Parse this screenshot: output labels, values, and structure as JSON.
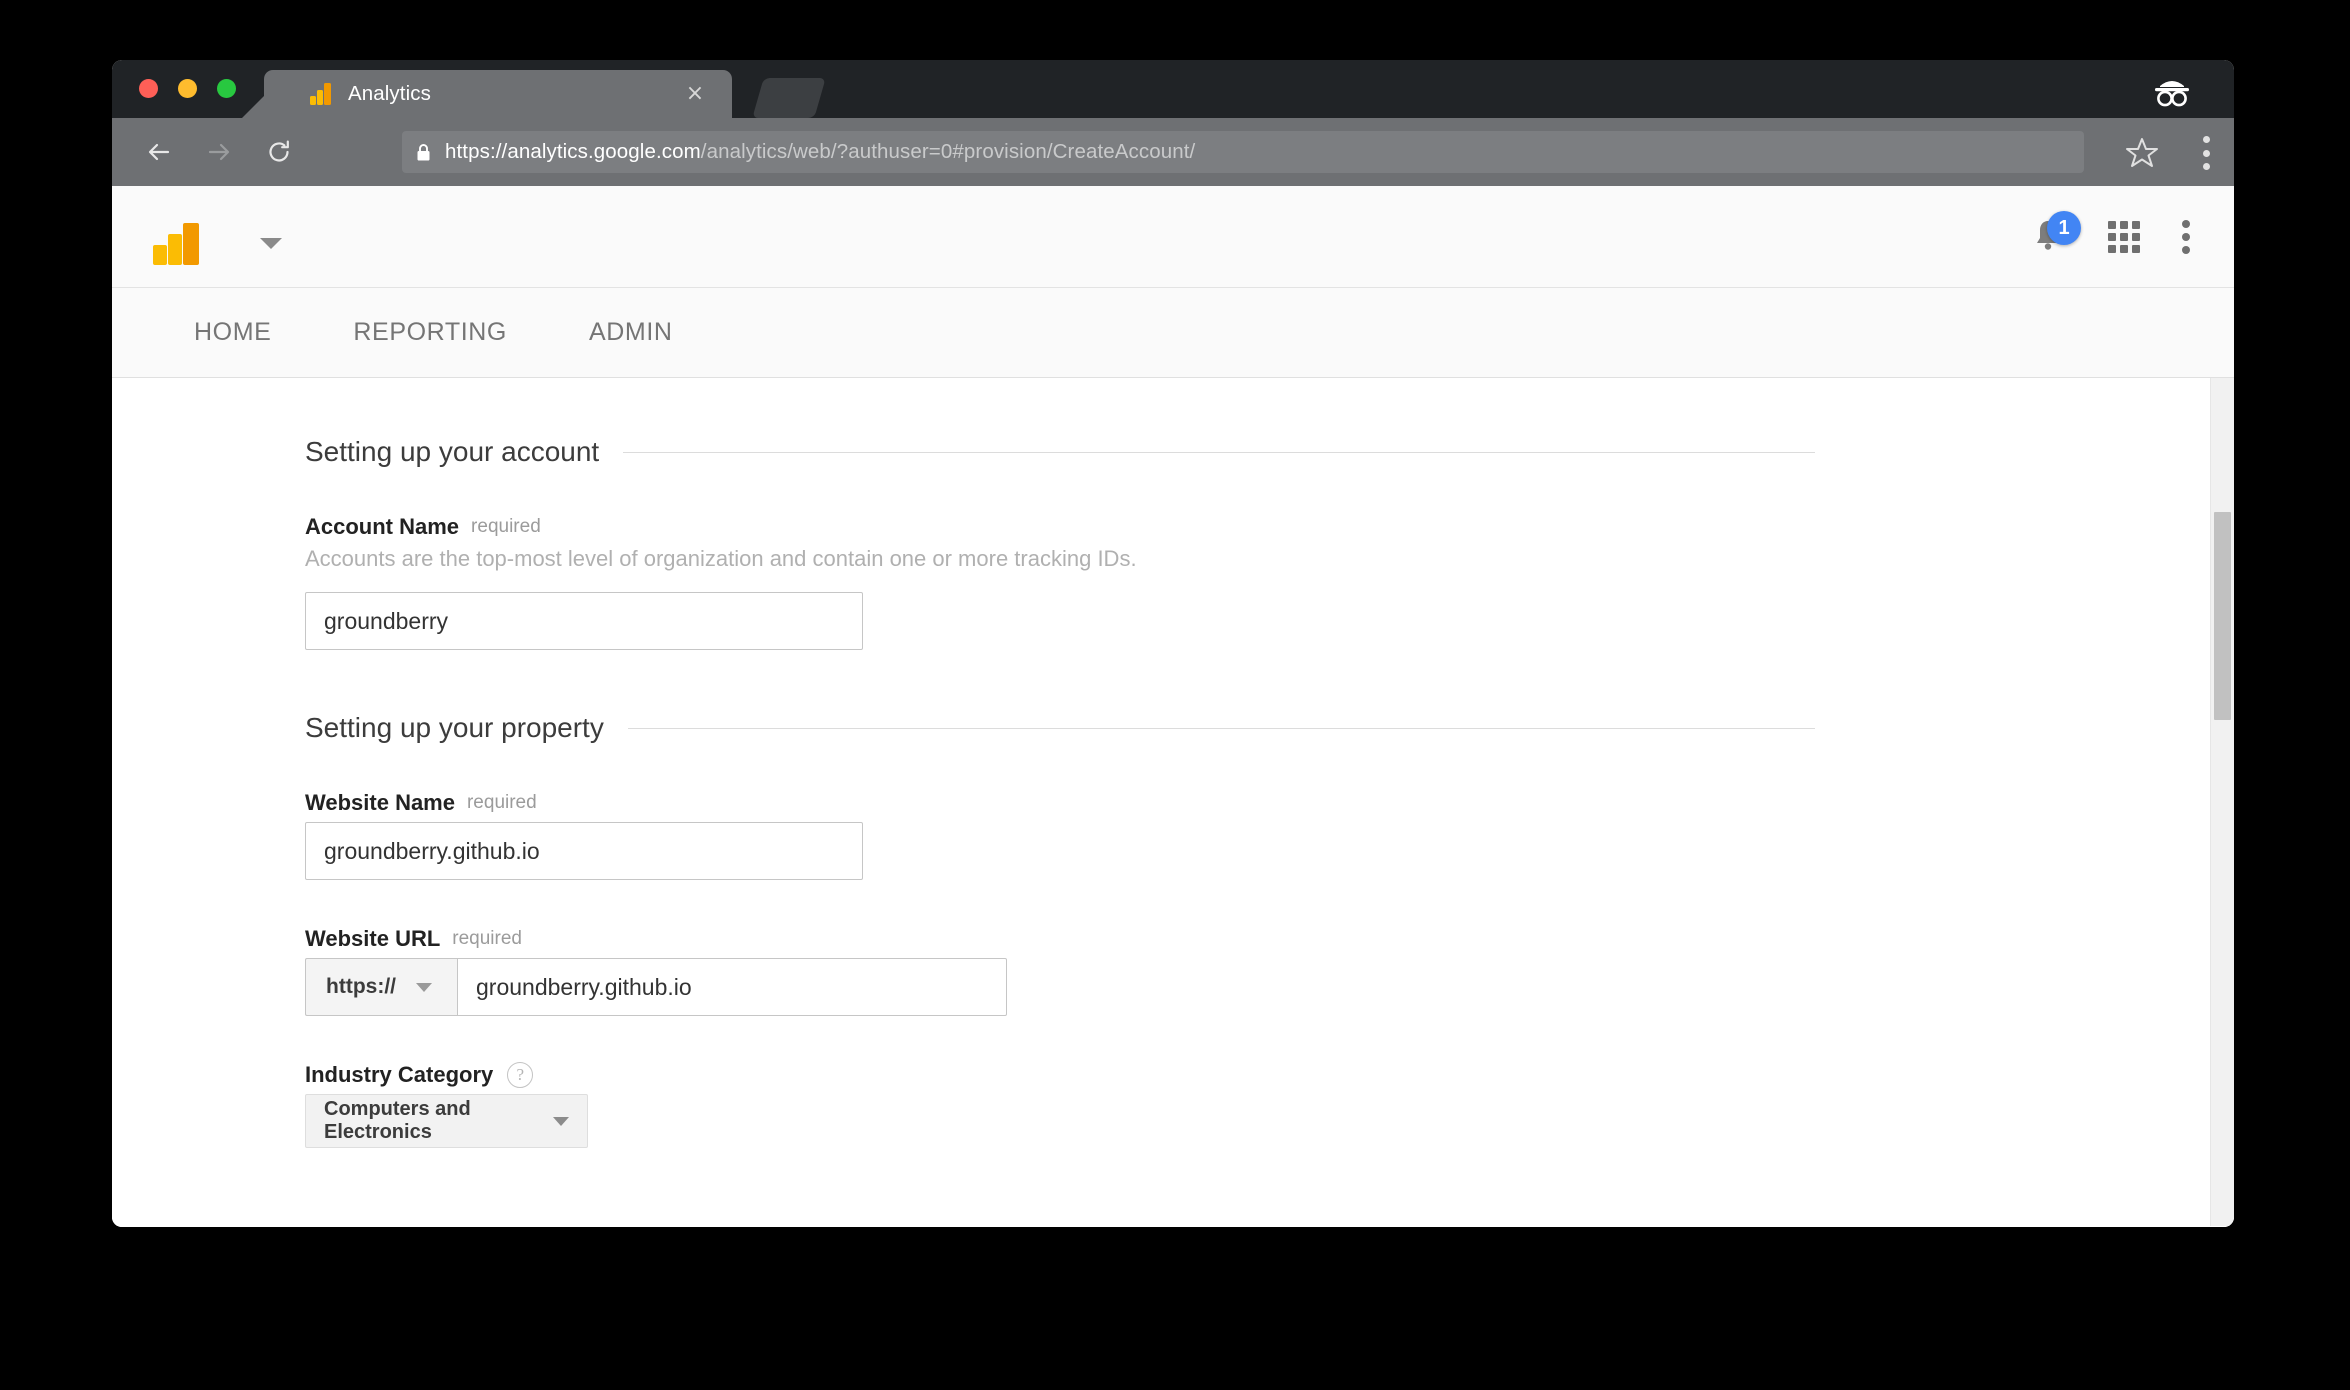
{
  "browser": {
    "tab": {
      "title": "Analytics",
      "favicon": "analytics-logo-icon",
      "close_label": "×"
    },
    "new_tab_label": "",
    "incognito_icon": "incognito-icon",
    "nav": {
      "back": "back-arrow-icon",
      "forward": "forward-arrow-icon",
      "reload": "reload-icon"
    },
    "omnibox": {
      "lock_icon": "lock-icon",
      "url_secure_part": "https://analytics.google.com",
      "url_path_part": "/analytics/web/?authuser=0#provision/CreateAccount/",
      "full_url": "https://analytics.google.com/analytics/web/?authuser=0#provision/CreateAccount/",
      "bookmark_icon": "star-outline-icon",
      "menu_icon": "three-dots-vertical-icon"
    }
  },
  "app_header": {
    "logo": "google-analytics-logo",
    "account_selector_icon": "chevron-down-icon",
    "notifications": {
      "icon": "bell-icon",
      "count": "1",
      "badge_color": "#4285f4"
    },
    "apps_icon": "apps-grid-icon",
    "overflow_icon": "three-dots-vertical-icon"
  },
  "nav_tabs": [
    {
      "label": "HOME",
      "name": "tab-home"
    },
    {
      "label": "REPORTING",
      "name": "tab-reporting"
    },
    {
      "label": "ADMIN",
      "name": "tab-admin"
    }
  ],
  "form": {
    "account_section": {
      "heading": "Setting up your account",
      "account_name": {
        "label": "Account Name",
        "required_text": "required",
        "description": "Accounts are the top-most level of organization and contain one or more tracking IDs.",
        "value": "groundberry",
        "placeholder": ""
      }
    },
    "property_section": {
      "heading": "Setting up your property",
      "website_name": {
        "label": "Website Name",
        "required_text": "required",
        "value": "groundberry.github.io",
        "placeholder": ""
      },
      "website_url": {
        "label": "Website URL",
        "required_text": "required",
        "protocol": "https://",
        "value": "groundberry.github.io",
        "placeholder": ""
      },
      "industry_category": {
        "label": "Industry Category",
        "help_icon": "?",
        "selected": "Computers and Electronics"
      }
    }
  },
  "colors": {
    "accent_blue": "#4285f4",
    "logo_yellow": "#fbbc04",
    "logo_orange": "#f29900"
  }
}
